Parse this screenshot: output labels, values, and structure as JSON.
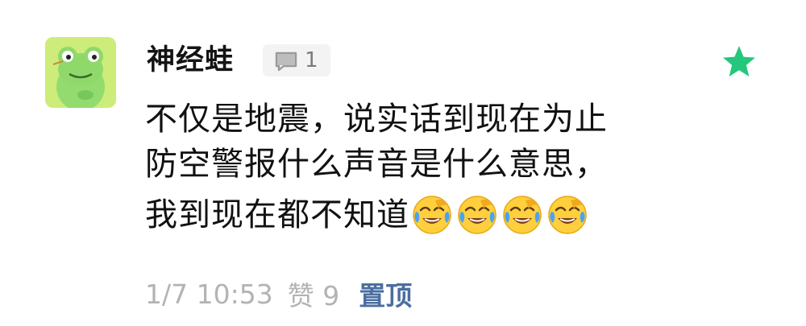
{
  "post": {
    "author": "神经蛙",
    "reply_count": "1",
    "lines": [
      "不仅是地震，说实话到现在为止",
      "防空警报什么声音是什么意思，",
      "我到现在都不知道"
    ],
    "emoji_icon": "crying-laughing-face-icon",
    "emoji_count": 4,
    "timestamp": "1/7 10:53",
    "likes": "赞 9",
    "pin_label": "置顶"
  },
  "icons": {
    "avatar": "frog-avatar",
    "reply": "speech-bubble-icon",
    "star": "star-icon"
  },
  "colors": {
    "star": "#25c77c",
    "pin": "#4a6ea0",
    "meta": "#b3b3b3",
    "badge_bg": "#f3f3f3"
  }
}
